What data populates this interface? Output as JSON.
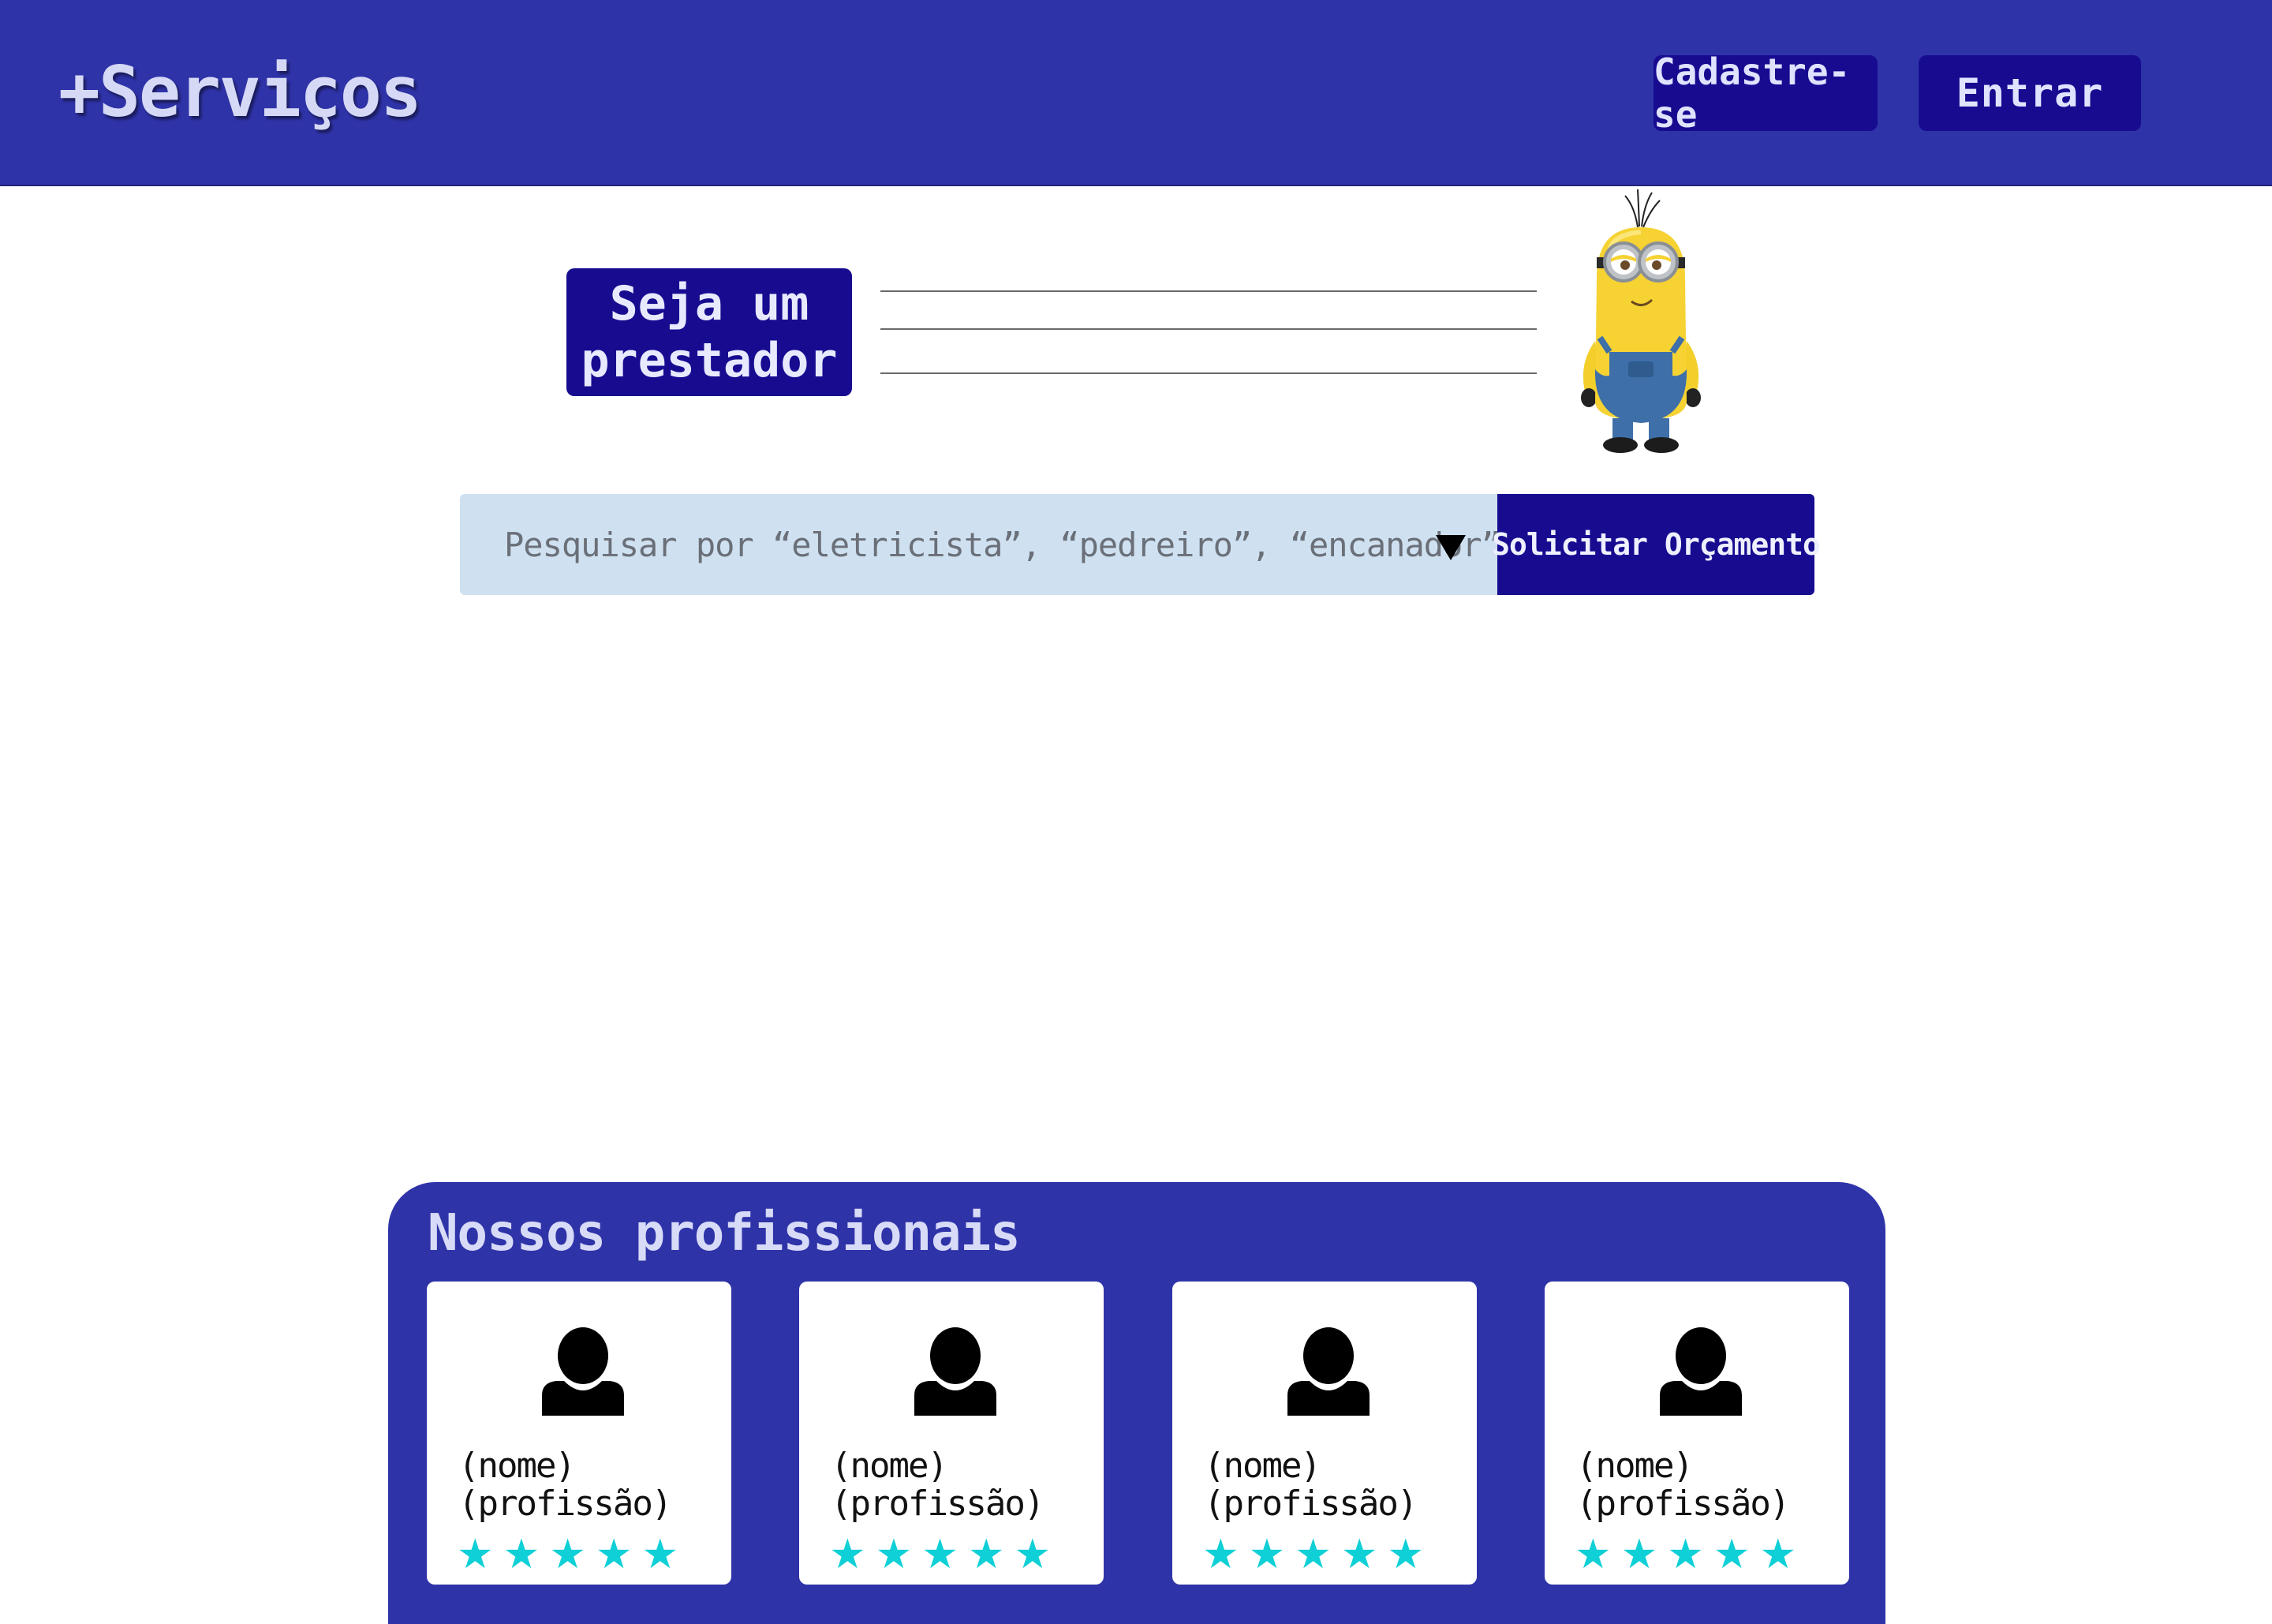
{
  "header": {
    "logo": "+Serviços",
    "signup_label": "Cadastre-se",
    "login_label": "Entrar"
  },
  "hero": {
    "provider_cta": "Seja um prestador",
    "mascot": "minion-mascot-image"
  },
  "search": {
    "placeholder": "Pesquisar por “eletricista”, “pedreiro”, “encanador”",
    "dropdown_icon": "triangle-down-icon",
    "submit_label": "Solicitar Orçamento"
  },
  "professionals": {
    "title": "Nossos profissionais",
    "cards": [
      {
        "name": "(nome)",
        "profession": "(profissão)",
        "rating": 5,
        "avatar_icon": "user-avatar-icon",
        "star_icon": "star-icon"
      },
      {
        "name": "(nome)",
        "profession": "(profissão)",
        "rating": 5,
        "avatar_icon": "user-avatar-icon",
        "star_icon": "star-icon"
      },
      {
        "name": "(nome)",
        "profession": "(profissão)",
        "rating": 5,
        "avatar_icon": "user-avatar-icon",
        "star_icon": "star-icon"
      },
      {
        "name": "(nome)",
        "profession": "(profissão)",
        "rating": 5,
        "avatar_icon": "user-avatar-icon",
        "star_icon": "star-icon"
      }
    ]
  },
  "colors": {
    "header_bg": "#2f33a8",
    "button_bg": "#170b90",
    "search_bg": "#cfe1f1",
    "star": "#0fd0d6"
  }
}
